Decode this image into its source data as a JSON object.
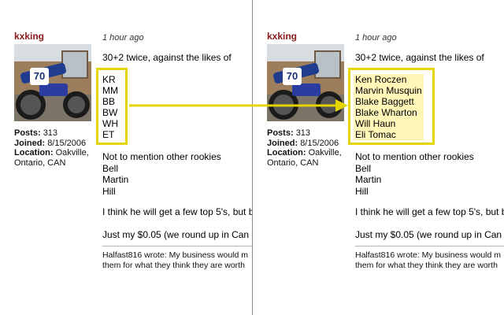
{
  "post": {
    "author": "kxking",
    "timestamp": "1 hour ago",
    "avatar_plate": "70",
    "stats": [
      {
        "label": "Posts:",
        "value": "313"
      },
      {
        "label": "Joined:",
        "value": "8/15/2006"
      },
      {
        "label": "Location:",
        "value": "Oakville, Ontario, CAN"
      }
    ],
    "intro": "30+2 twice, against the likes of",
    "abbreviations": [
      "KR",
      "MM",
      "BB",
      "BW",
      "WH",
      "ET"
    ],
    "full_names": [
      "Ken Roczen",
      "Marvin Musquin",
      "Blake Baggett",
      "Blake Wharton",
      "Will Haun",
      "Eli Tomac"
    ],
    "rookies_intro": "Not to mention other rookies",
    "rookies": [
      "Bell",
      "Martin",
      "Hill"
    ],
    "opinion": "I think he will get a few top 5's, but b",
    "cents": "Just my $0.05 (we round up in Can",
    "quote_line1": "Halfast816 wrote: My business would m",
    "quote_line2": "them for what they think they are worth"
  },
  "colors": {
    "author": "#8b1a1a",
    "highlight_border": "#e4d400",
    "highlight_fill": "#fff6b8",
    "divider": "#8a8a8a"
  },
  "icons": [
    "arrow-right-icon"
  ]
}
